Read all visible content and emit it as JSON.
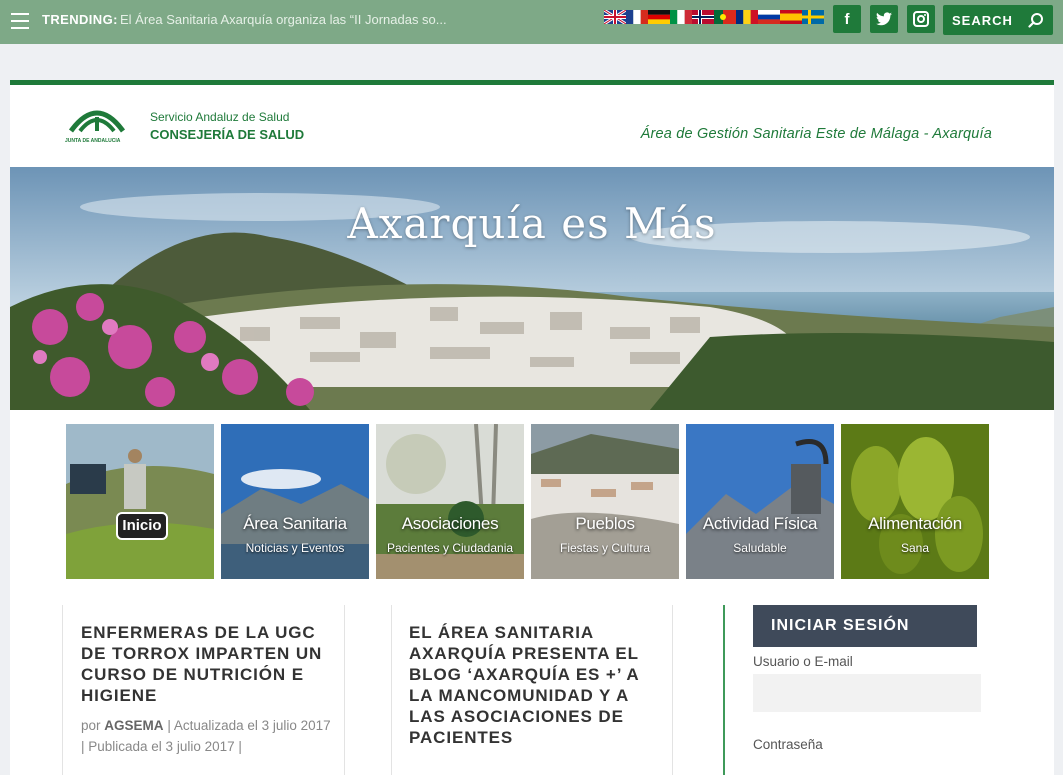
{
  "topbar": {
    "trending_label": "TRENDING:",
    "trending_text": "El Área Sanitaria Axarquía organiza las “II Jornadas so...",
    "flags": [
      "uk-flag",
      "france-flag",
      "germany-flag",
      "italy-flag",
      "norway-flag",
      "portugal-flag",
      "romania-flag",
      "russia-flag",
      "spain-flag",
      "sweden-flag"
    ],
    "social": [
      {
        "name": "facebook-icon",
        "glyph": "f"
      },
      {
        "name": "twitter-icon",
        "glyph": "🐦"
      },
      {
        "name": "instagram-icon",
        "glyph": "◙"
      }
    ],
    "search_label": "SEARCH"
  },
  "header": {
    "org_line1": "Servicio Andaluz de Salud",
    "org_line2": "CONSEJERÍA DE SALUD",
    "junta": "JUNTA DE ANDALUCIA",
    "area_title": "Área de Gestión Sanitaria Este de Málaga - Axarquía"
  },
  "hero": {
    "title": "Axarquía es Más"
  },
  "tiles": [
    {
      "title": "Inicio",
      "subtitle": ""
    },
    {
      "title": "Área Sanitaria",
      "subtitle": "Noticias y Eventos"
    },
    {
      "title": "Asociaciones",
      "subtitle": "Pacientes y Ciudadania"
    },
    {
      "title": "Pueblos",
      "subtitle": "Fiestas y Cultura"
    },
    {
      "title": "Actividad Física",
      "subtitle": "Saludable"
    },
    {
      "title": "Alimentación",
      "subtitle": "Sana"
    }
  ],
  "posts": [
    {
      "title": "ENFERMERAS DE LA UGC DE TORROX IMPARTEN UN CURSO DE NUTRICIÓN E HIGIENE",
      "meta_by": "por",
      "meta_author": "AGSEMA",
      "meta_rest": "| Actualizada el 3 julio 2017 | Publicada el 3 julio 2017 |"
    },
    {
      "title": "EL ÁREA SANITARIA AXARQUÍA PRESENTA EL BLOG ‘AXARQUÍA ES +’ A LA MANCOMUNIDAD Y A LAS ASOCIACIONES DE PACIENTES"
    }
  ],
  "login": {
    "heading": "INICIAR SESIÓN",
    "user_label": "Usuario o E-mail",
    "password_label": "Contraseña"
  },
  "colors": {
    "topbar": "#7ea987",
    "brand_green": "#1f7a3a",
    "login_head": "#3f4a5a"
  }
}
